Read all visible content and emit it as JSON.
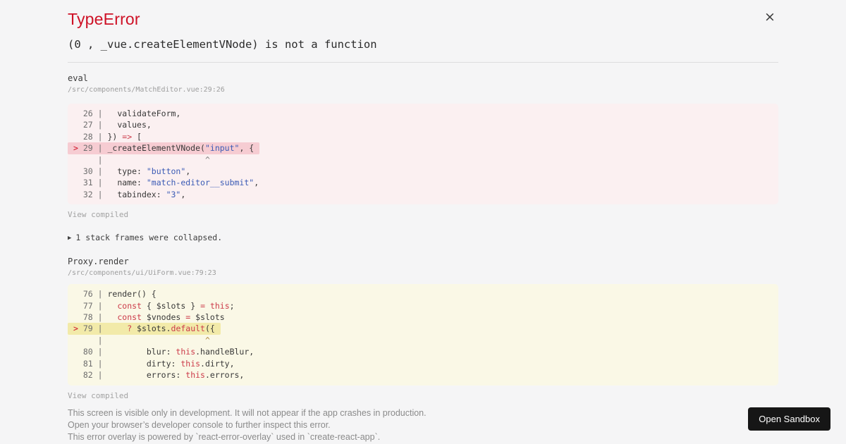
{
  "overlay": {
    "title": "TypeError",
    "message": "(0 , _vue.createElementVNode) is not a function",
    "close_icon": "×"
  },
  "colors": {
    "accent_red": "#ce1126",
    "string_blue": "#3b5bb5",
    "keyword_red": "#cc3b4a",
    "block_red_bg": "#fbf0f1",
    "block_red_highlight": "#f6ccd2",
    "block_yellow_bg": "#faf8e6",
    "block_yellow_highlight": "#f2eaa9",
    "button_bg": "#161616"
  },
  "frames": [
    {
      "fn": "eval",
      "path": "/src/components/MatchEditor.vue:29:26",
      "view_label": "View compiled",
      "variant": "red",
      "lines": [
        {
          "pre": " ",
          "num": " 26 |",
          "hl": false,
          "segs": [
            [
              "d",
              "   validateForm,"
            ]
          ]
        },
        {
          "pre": " ",
          "num": " 27 |",
          "hl": false,
          "segs": [
            [
              "d",
              "   values,"
            ]
          ]
        },
        {
          "pre": " ",
          "num": " 28 |",
          "hl": false,
          "segs": [
            [
              "d",
              " }) "
            ],
            [
              "k",
              "=>"
            ],
            [
              "d",
              " ["
            ]
          ]
        },
        {
          "pre": ">",
          "num": " 29 |",
          "hl": true,
          "segs": [
            [
              "d",
              " _createElementVNode("
            ],
            [
              "s",
              "\"input\""
            ],
            [
              "d",
              ", {"
            ]
          ]
        },
        {
          "pre": " ",
          "num": "    |",
          "hl": false,
          "segs": [
            [
              "c",
              "                     ^"
            ]
          ]
        },
        {
          "pre": " ",
          "num": " 30 |",
          "hl": false,
          "segs": [
            [
              "d",
              "   type: "
            ],
            [
              "s",
              "\"button\""
            ],
            [
              "d",
              ","
            ]
          ]
        },
        {
          "pre": " ",
          "num": " 31 |",
          "hl": false,
          "segs": [
            [
              "d",
              "   name: "
            ],
            [
              "s",
              "\"match-editor__submit\""
            ],
            [
              "d",
              ","
            ]
          ]
        },
        {
          "pre": " ",
          "num": " 32 |",
          "hl": false,
          "segs": [
            [
              "d",
              "   tabindex: "
            ],
            [
              "s",
              "\"3\""
            ],
            [
              "d",
              ","
            ]
          ]
        }
      ]
    },
    {
      "fn": "Proxy.render",
      "path": "/src/components/ui/UiForm.vue:79:23",
      "view_label": "View compiled",
      "variant": "yellow",
      "lines": [
        {
          "pre": " ",
          "num": " 76 |",
          "hl": false,
          "segs": [
            [
              "d",
              " render() {"
            ]
          ]
        },
        {
          "pre": " ",
          "num": " 77 |",
          "hl": false,
          "segs": [
            [
              "d",
              "   "
            ],
            [
              "k",
              "const"
            ],
            [
              "d",
              " { $slots } "
            ],
            [
              "k",
              "="
            ],
            [
              "d",
              " "
            ],
            [
              "k",
              "this"
            ],
            [
              "d",
              ";"
            ]
          ]
        },
        {
          "pre": " ",
          "num": " 78 |",
          "hl": false,
          "segs": [
            [
              "d",
              "   "
            ],
            [
              "k",
              "const"
            ],
            [
              "d",
              " $vnodes "
            ],
            [
              "k",
              "="
            ],
            [
              "d",
              " $slots"
            ]
          ]
        },
        {
          "pre": ">",
          "num": " 79 |",
          "hl": true,
          "segs": [
            [
              "d",
              "     "
            ],
            [
              "k",
              "?"
            ],
            [
              "d",
              " $slots."
            ],
            [
              "k",
              "default"
            ],
            [
              "d",
              "({"
            ]
          ]
        },
        {
          "pre": " ",
          "num": "    |",
          "hl": false,
          "segs": [
            [
              "c",
              "                     ^"
            ]
          ]
        },
        {
          "pre": " ",
          "num": " 80 |",
          "hl": false,
          "segs": [
            [
              "d",
              "         blur: "
            ],
            [
              "k",
              "this"
            ],
            [
              "d",
              ".handleBlur,"
            ]
          ]
        },
        {
          "pre": " ",
          "num": " 81 |",
          "hl": false,
          "segs": [
            [
              "d",
              "         dirty: "
            ],
            [
              "k",
              "this"
            ],
            [
              "d",
              ".dirty,"
            ]
          ]
        },
        {
          "pre": " ",
          "num": " 82 |",
          "hl": false,
          "segs": [
            [
              "d",
              "         errors: "
            ],
            [
              "k",
              "this"
            ],
            [
              "d",
              ".errors,"
            ]
          ]
        }
      ]
    }
  ],
  "collapsed": {
    "icon": "▶",
    "label": "1 stack frames were collapsed."
  },
  "footer": {
    "lines": [
      "This screen is visible only in development. It will not appear if the app crashes in production.",
      "Open your browser’s developer console to further inspect this error.",
      "This error overlay is powered by `react-error-overlay` used in `create-react-app`."
    ],
    "button_label": "Open Sandbox"
  }
}
